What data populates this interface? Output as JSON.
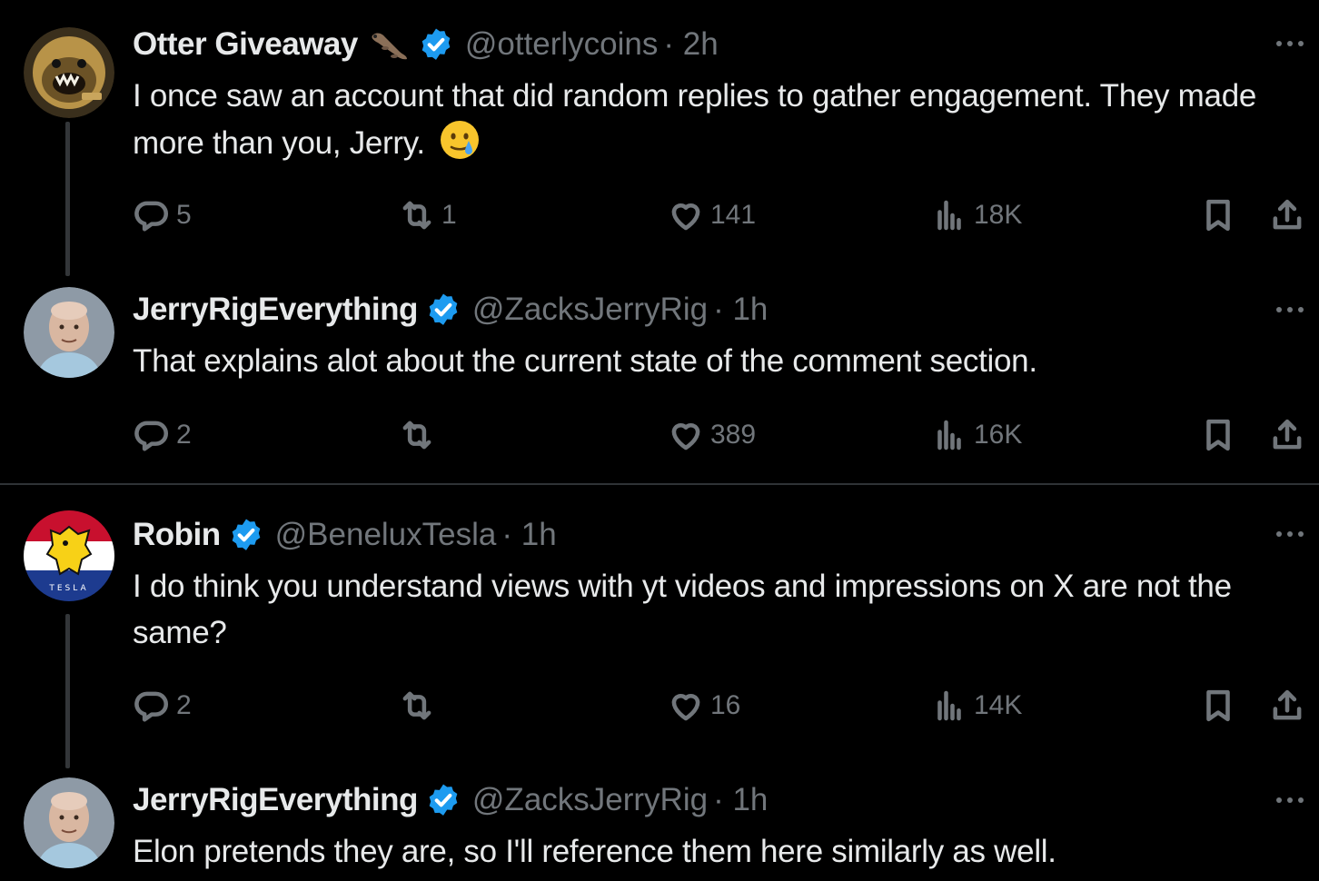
{
  "tweets": [
    {
      "name": "Otter Giveaway",
      "handle": "@otterlycoins",
      "time": "· 2h",
      "text": "I once saw an account that did random replies to gather engagement. They made more than you, Jerry.",
      "emoji": "sad-smile-tear-icon",
      "avatar": "otter-avatar",
      "replies": "5",
      "reposts": "1",
      "likes": "141",
      "views": "18K"
    },
    {
      "name": "JerryRigEverything",
      "handle": "@ZacksJerryRig",
      "time": "· 1h",
      "text": "That explains alot about the current state of the comment section.",
      "avatar": "jerry-avatar",
      "replies": "2",
      "reposts": "",
      "likes": "389",
      "views": "16K"
    },
    {
      "name": "Robin",
      "handle": "@BeneluxTesla",
      "time": "· 1h",
      "text": "I do think you understand views with yt videos and impressions on X are not the same?",
      "avatar": "benelux-lion-avatar",
      "replies": "2",
      "reposts": "",
      "likes": "16",
      "views": "14K"
    },
    {
      "name": "JerryRigEverything",
      "handle": "@ZacksJerryRig",
      "time": "· 1h",
      "text": "Elon pretends they are, so I'll reference them here similarly as well.",
      "avatar": "jerry-avatar"
    }
  ],
  "colors": {
    "background": "#000000",
    "text": "#e7e9ea",
    "muted": "#71767b",
    "verified": "#1d9bf0",
    "divider": "#2f3336"
  }
}
